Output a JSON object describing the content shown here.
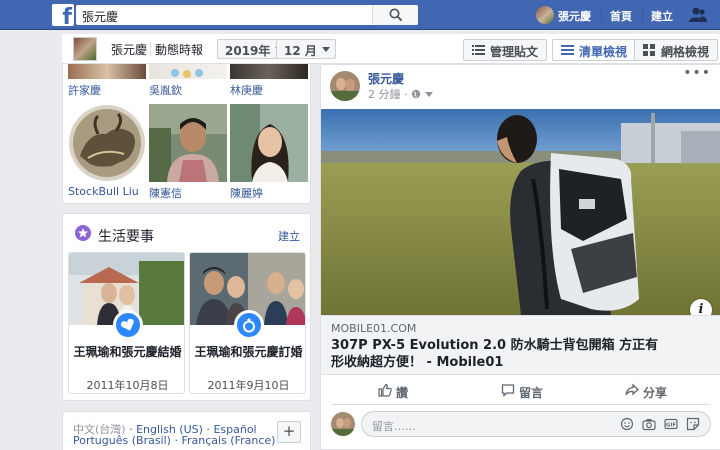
{
  "topbar": {
    "logo_letter": "f",
    "search_value": "張元慶",
    "user_name": "張元慶",
    "home_link": "首頁",
    "create_link": "建立",
    "brand_color": "#4267b2"
  },
  "subbar": {
    "name": "張元慶",
    "section": "動態時報",
    "year": "2019年",
    "month": "12 月",
    "manage_posts": "管理貼文",
    "list_view": "清單檢視",
    "grid_view": "網格檢視"
  },
  "friends": {
    "top_names": [
      "許家慶",
      "吳胤欽",
      "林庚慶"
    ],
    "bottom_names": [
      "StockBull Liu",
      "陳憲信",
      "陳麗婷"
    ]
  },
  "life_events": {
    "title": "生活要事",
    "create": "建立",
    "items": [
      {
        "title": "王珮瑜和張元慶結婚",
        "date": "2011年10月8日"
      },
      {
        "title": "王珮瑜和張元慶訂婚",
        "date": "2011年9月10日"
      }
    ]
  },
  "languages": {
    "line1": [
      "中文(台灣)",
      "English (US)",
      "Español"
    ],
    "line2": [
      "Português (Brasil)",
      "Français (France)"
    ],
    "plus": "+"
  },
  "post": {
    "author": "張元慶",
    "time": "2 分鐘",
    "more": "•••",
    "info": "i",
    "link_domain": "MOBILE01.COM",
    "link_title": "307P PX-5 Evolution 2.0 防水騎士背包開箱 方正有形收納超方便！ - Mobile01",
    "actions": {
      "like": "讚",
      "comment": "留言",
      "share": "分享"
    },
    "comment_placeholder": "留言……"
  }
}
